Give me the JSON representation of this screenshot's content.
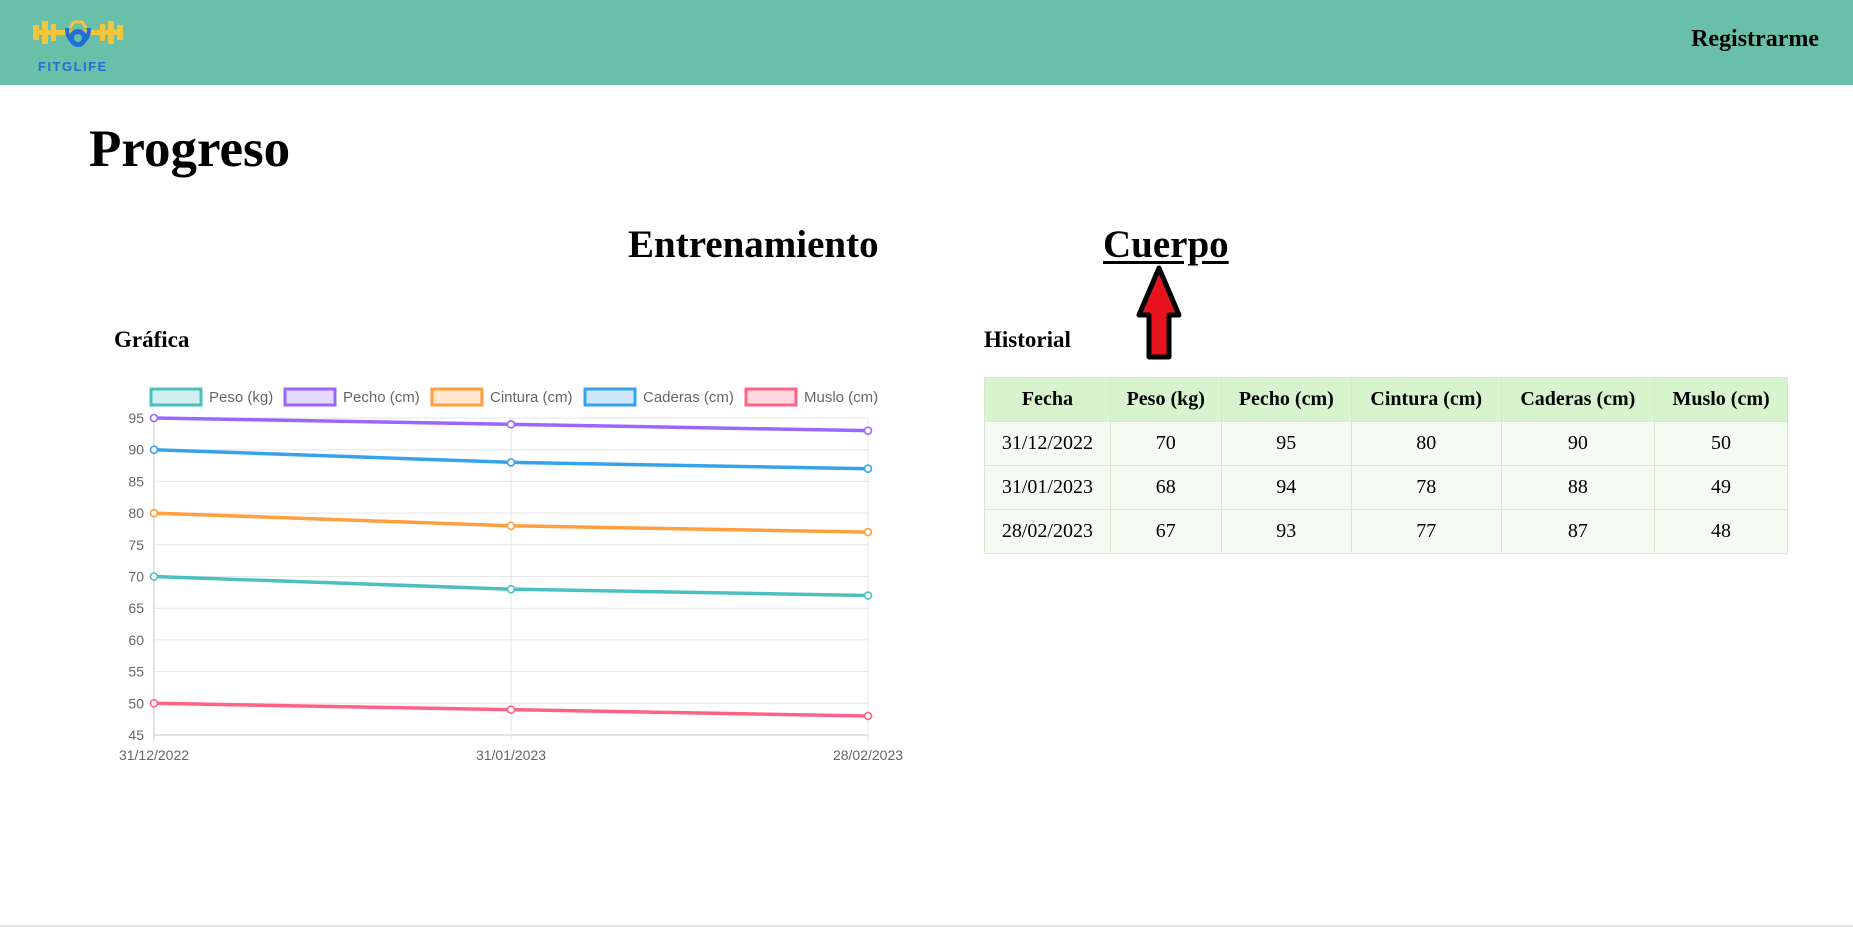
{
  "header": {
    "logo_text": "FITGLIFE",
    "register_label": "Registrarme",
    "bar_color": "#69bfa7"
  },
  "page": {
    "title": "Progreso"
  },
  "tabs": {
    "entrenamiento": "Entrenamiento",
    "cuerpo": "Cuerpo",
    "active": "cuerpo"
  },
  "annotation": {
    "icon": "red-up-arrow-icon",
    "color": "#e8141d"
  },
  "sections": {
    "grafica": "Gráfica",
    "historial": "Historial"
  },
  "chart_data": {
    "type": "line",
    "categories": [
      "31/12/2022",
      "31/01/2023",
      "28/02/2023"
    ],
    "ylim": [
      45,
      95
    ],
    "yticks": [
      45,
      50,
      55,
      60,
      65,
      70,
      75,
      80,
      85,
      90,
      95
    ],
    "grid": true,
    "legend_position": "top",
    "series": [
      {
        "name": "Peso (kg)",
        "color": "#4bc0c0",
        "values": [
          70,
          68,
          67
        ]
      },
      {
        "name": "Pecho (cm)",
        "color": "#9966ff",
        "values": [
          95,
          94,
          93
        ]
      },
      {
        "name": "Cintura (cm)",
        "color": "#ff9f40",
        "values": [
          80,
          78,
          77
        ]
      },
      {
        "name": "Caderas (cm)",
        "color": "#36a2eb",
        "values": [
          90,
          88,
          87
        ]
      },
      {
        "name": "Muslo (cm)",
        "color": "#ff6384",
        "values": [
          50,
          49,
          48
        ]
      }
    ]
  },
  "history": {
    "columns": [
      "Fecha",
      "Peso (kg)",
      "Pecho (cm)",
      "Cintura (cm)",
      "Caderas (cm)",
      "Muslo (cm)"
    ],
    "rows": [
      [
        "31/12/2022",
        "70",
        "95",
        "80",
        "90",
        "50"
      ],
      [
        "31/01/2023",
        "68",
        "94",
        "78",
        "88",
        "49"
      ],
      [
        "28/02/2023",
        "67",
        "93",
        "77",
        "87",
        "48"
      ]
    ]
  }
}
